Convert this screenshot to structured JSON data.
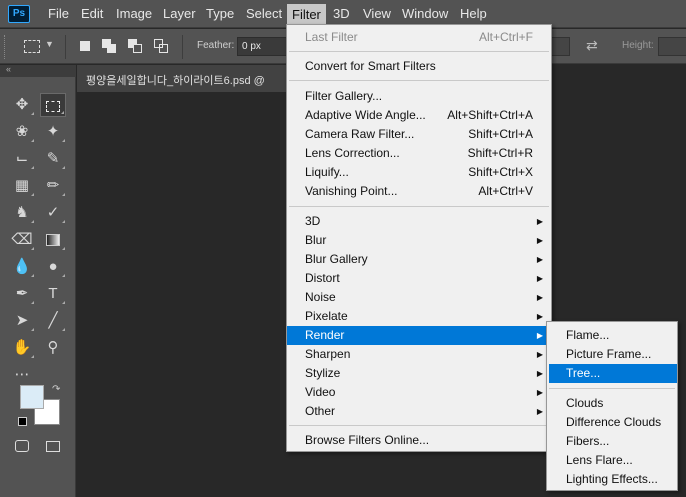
{
  "app": {
    "logo_text": "Ps",
    "brand_color": "#31a8ff",
    "highlight_color": "#0078d7"
  },
  "menubar": {
    "items": [
      "File",
      "Edit",
      "Image",
      "Layer",
      "Type",
      "Select",
      "Filter",
      "3D",
      "View",
      "Window",
      "Help"
    ],
    "active": "Filter"
  },
  "options_bar": {
    "feather_label": "Feather:",
    "feather_value": "0 px",
    "height_label": "Height:"
  },
  "document": {
    "tab_title": "평양을세일합니다_하이라이트6.psd @"
  },
  "tools": {
    "foreground_color": "#dbecf7",
    "background_color": "#ffffff",
    "icons": [
      "move-tool-icon",
      "rectangular-marquee-icon",
      "lasso-icon",
      "magic-wand-icon",
      "crop-icon",
      "eyedropper-icon",
      "frame-icon",
      "brush-icon",
      "clone-stamp-icon",
      "history-brush-icon",
      "eraser-icon",
      "gradient-icon",
      "blur-icon",
      "dodge-icon",
      "pen-icon",
      "type-icon",
      "path-selection-icon",
      "line-icon",
      "hand-icon",
      "zoom-icon",
      "more-tools-icon",
      "quick-mask-icon",
      "screen-mode-icon"
    ]
  },
  "filter_menu": {
    "last_filter": {
      "label": "Last Filter",
      "shortcut": "Alt+Ctrl+F"
    },
    "convert_smart": "Convert for Smart Filters",
    "gallery_group": [
      {
        "label": "Filter Gallery...",
        "shortcut": ""
      },
      {
        "label": "Adaptive Wide Angle...",
        "shortcut": "Alt+Shift+Ctrl+A"
      },
      {
        "label": "Camera Raw Filter...",
        "shortcut": "Shift+Ctrl+A"
      },
      {
        "label": "Lens Correction...",
        "shortcut": "Shift+Ctrl+R"
      },
      {
        "label": "Liquify...",
        "shortcut": "Shift+Ctrl+X"
      },
      {
        "label": "Vanishing Point...",
        "shortcut": "Alt+Ctrl+V"
      }
    ],
    "submenus": [
      "3D",
      "Blur",
      "Blur Gallery",
      "Distort",
      "Noise",
      "Pixelate",
      "Render",
      "Sharpen",
      "Stylize",
      "Video",
      "Other"
    ],
    "highlighted": "Render",
    "browse_online": "Browse Filters Online..."
  },
  "render_submenu": {
    "items_top": [
      "Flame...",
      "Picture Frame...",
      "Tree..."
    ],
    "items_bottom": [
      "Clouds",
      "Difference Clouds",
      "Fibers...",
      "Lens Flare...",
      "Lighting Effects..."
    ],
    "highlighted": "Tree..."
  }
}
